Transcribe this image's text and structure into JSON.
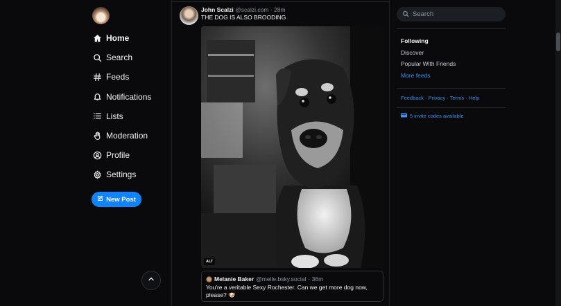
{
  "nav": {
    "items": [
      {
        "label": "Home",
        "icon": "home-icon"
      },
      {
        "label": "Search",
        "icon": "search-icon"
      },
      {
        "label": "Feeds",
        "icon": "hash-icon"
      },
      {
        "label": "Notifications",
        "icon": "bell-icon"
      },
      {
        "label": "Lists",
        "icon": "list-icon"
      },
      {
        "label": "Moderation",
        "icon": "hand-icon"
      },
      {
        "label": "Profile",
        "icon": "user-circle-icon"
      },
      {
        "label": "Settings",
        "icon": "gear-icon"
      }
    ],
    "new_post_label": "New Post"
  },
  "post": {
    "author_name": "John Scalzi",
    "author_handle": "@scalzi.com",
    "time": "· 28m",
    "text": "THE DOG IS ALSO BROODING",
    "image_alt_badge": "ALT",
    "quote": {
      "author_name": "Melanie Baker",
      "author_handle": "@melle.bsky.social",
      "time": "· 36m",
      "text": "You're a veritable Sexy Rochester. Can we get more dog now, please? 🐶"
    }
  },
  "right": {
    "search_placeholder": "Search",
    "feeds": [
      "Following",
      "Discover",
      "Popular With Friends"
    ],
    "more_feeds": "More feeds",
    "footer": {
      "feedback": "Feedback",
      "privacy": "Privacy",
      "terms": "Terms",
      "help": "Help",
      "sep": " · "
    },
    "invite_codes": "5 invite codes available"
  },
  "colors": {
    "accent": "#1083fe",
    "link": "#3f8fe8",
    "background": "#0a0a0c"
  }
}
